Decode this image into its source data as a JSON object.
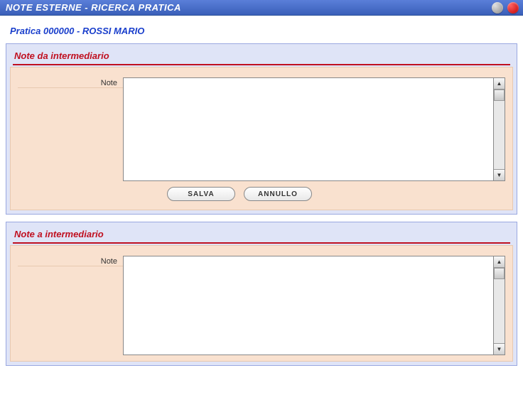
{
  "window": {
    "title": "NOTE ESTERNE - RICERCA PRATICA"
  },
  "header": {
    "pratica_line": "Pratica  000000 - ROSSI MARIO"
  },
  "sections": {
    "da_intermediario": {
      "title": "Note da intermediario",
      "note_label": "Note",
      "note_value": "",
      "buttons": {
        "salva": "SALVA",
        "annullo": "ANNULLO"
      }
    },
    "a_intermediario": {
      "title": "Note a intermediario",
      "note_label": "Note",
      "note_value": ""
    }
  }
}
